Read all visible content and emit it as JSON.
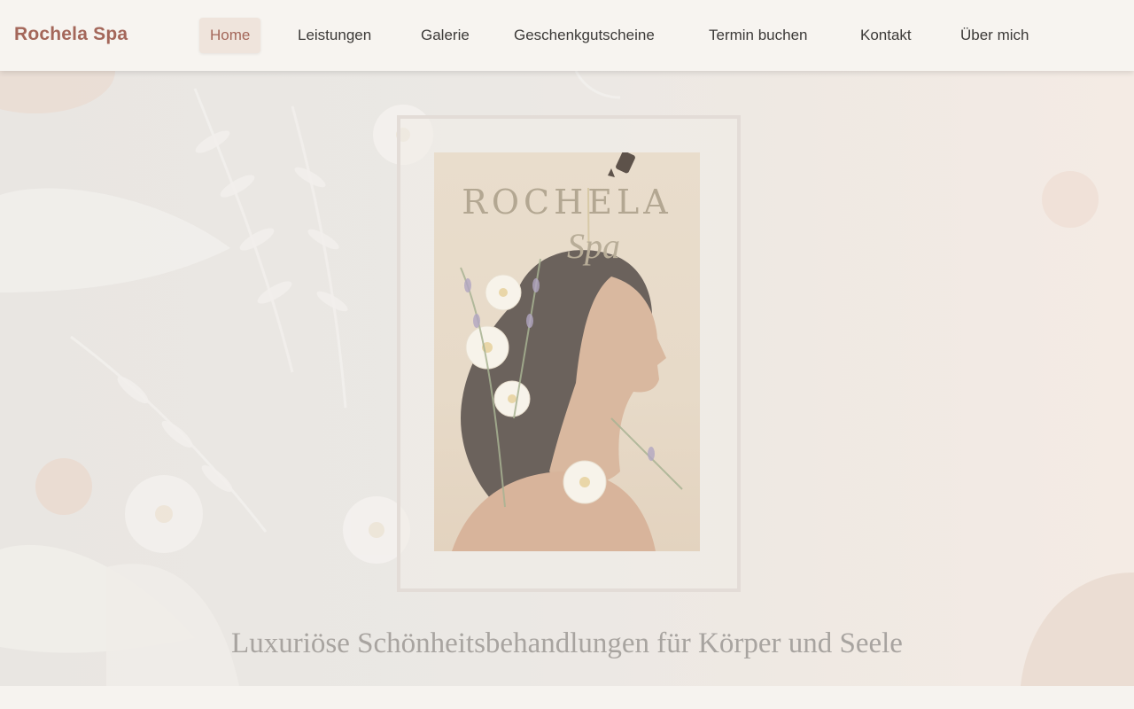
{
  "brand": {
    "name": "Rochela Spa"
  },
  "nav": {
    "items": [
      {
        "label": "Home",
        "active": true
      },
      {
        "label": "Leistungen",
        "active": false
      },
      {
        "label": "Galerie",
        "active": false
      },
      {
        "label": "Geschenkgutscheine",
        "active": false
      },
      {
        "label": "Termin buchen",
        "active": false
      },
      {
        "label": "Kontakt",
        "active": false
      },
      {
        "label": "Über mich",
        "active": false
      }
    ]
  },
  "hero": {
    "poster": {
      "title": "ROCHELA",
      "script": "Spa"
    },
    "tagline": "Luxuriöse Schönheitsbehandlungen für Körper und Seele"
  },
  "colors": {
    "accent": "#a4675a",
    "header_bg": "#f7f4f0",
    "nav_text": "#3c3a38",
    "active_bg": "#efe4dc",
    "tagline": "#a8a4a0"
  },
  "icons": [
    "flower-decoration",
    "woman-portrait-illustration",
    "dropper-icon"
  ]
}
